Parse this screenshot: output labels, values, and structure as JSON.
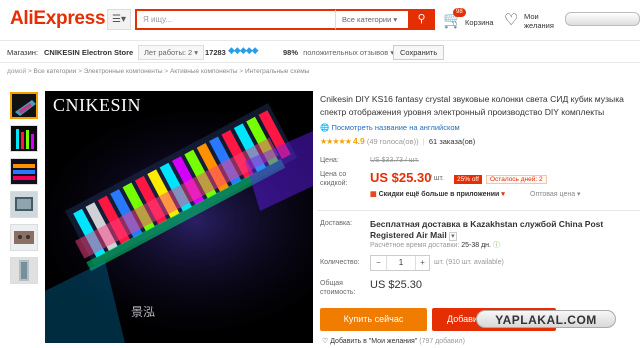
{
  "header": {
    "logo": "AliExpress",
    "search_placeholder": "Я ищу...",
    "category_select": "Все категории",
    "cart_badge": "98",
    "cart_label": "Корзина",
    "wishlist_label_1": "Мои",
    "wishlist_label_2": "желания"
  },
  "store": {
    "label": "Магазин:",
    "name": "CNIKESIN Electron Store",
    "years_open": "Лет работы: 2",
    "score": "17283",
    "positive_pct": "98%",
    "positive_label": "положительных отзывов",
    "save_label": "Сохранить"
  },
  "breadcrumb": {
    "items": [
      "домой",
      "Все категории",
      "Электронные компоненты",
      "Активные компоненты",
      "Интегральные схемы"
    ]
  },
  "gallery": {
    "brand_text": "CNIKESIN",
    "signature_text": "景泓"
  },
  "product": {
    "title": "Cnikesin DIY KS16 fantasy crystal звуковые колонки света СИД кубик музыка спектр отображения уровня электронный производство DIY комплекты",
    "translate_link": "Посмотреть название на английском",
    "rating": "4.9",
    "votes": "(49 голоса(ов))",
    "orders": "61 заказа(ов)"
  },
  "price": {
    "label_price": "Цена:",
    "old_price": "US $33.73 / шт.",
    "label_discount_1": "Цена со",
    "label_discount_2": "скидкой:",
    "price": "US $25.30",
    "per_unit": "/ шт.",
    "off": "25% off",
    "time_left": "Осталось дней: 2",
    "extra_discount": "Скидки ещё больше в приложении",
    "wholesale": "Оптовая цена"
  },
  "shipping": {
    "label": "Доставка:",
    "title": "Бесплатная доставка в Kazakhstan службой China Post Registered Air Mail",
    "time_label": "Расчётное время доставки:",
    "time_value": "25-38 дн."
  },
  "quantity": {
    "label": "Количество:",
    "minus": "−",
    "value": "1",
    "plus": "+",
    "unit": "шт. (910 шт. available)"
  },
  "total": {
    "label_1": "Общая",
    "label_2": "стоимость:",
    "value": "US $25.30"
  },
  "actions": {
    "buy_now": "Купить сейчас",
    "add_to_cart": "Добавить в корзину",
    "add_wishlist": "Добавить в \"Мои желания\"",
    "wish_count": "(797 добавил)"
  },
  "watermark": "YAPLAKAL.COM",
  "colors": {
    "brand": "#e62e04",
    "buy_button": "#f07c00",
    "rating_star": "#f5a200",
    "link": "#2a6ebb"
  }
}
